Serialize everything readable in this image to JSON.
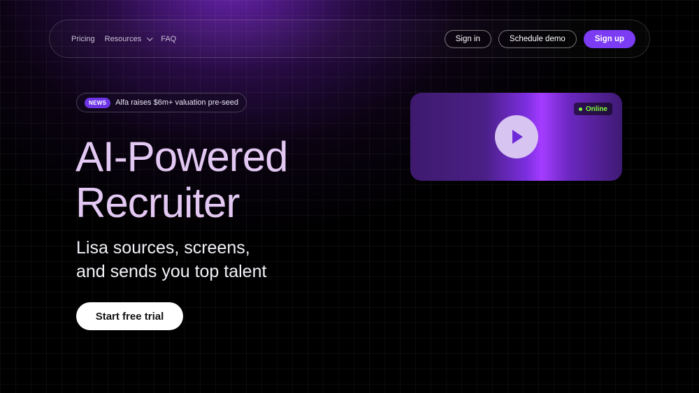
{
  "nav": {
    "links": [
      {
        "label": "Pricing"
      },
      {
        "label": "Resources"
      },
      {
        "label": "FAQ"
      }
    ],
    "sign_in": "Sign in",
    "schedule_demo": "Schedule demo",
    "sign_up": "Sign up"
  },
  "announcement": {
    "badge": "NEWS",
    "text": "Alfa raises $6m+ valuation pre-seed"
  },
  "hero": {
    "headline_line1": "AI-Powered",
    "headline_line2": "Recruiter",
    "subhead_line1": "Lisa sources, screens,",
    "subhead_line2": "and sends you top talent",
    "cta": "Start free trial"
  },
  "video": {
    "status": "Online",
    "play_icon": "play-icon"
  },
  "colors": {
    "accent": "#7b3cf3",
    "headline": "#e2c8f2",
    "online": "#7dfc3c"
  }
}
